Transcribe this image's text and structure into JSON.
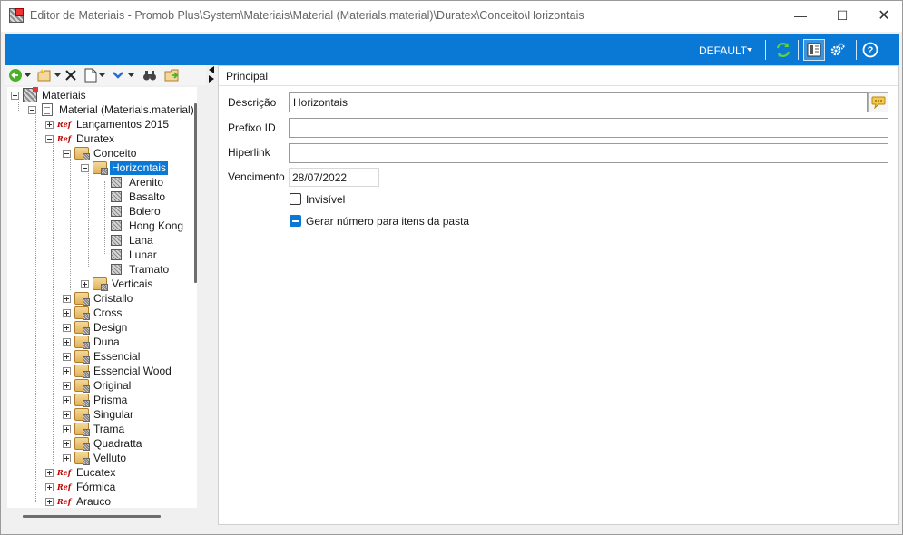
{
  "window": {
    "title": "Editor de Materiais - Promob Plus\\System\\Materiais\\Material (Materials.material)\\Duratex\\Conceito\\Horizontais",
    "minimize_glyph": "—",
    "maximize_glyph": "☐",
    "close_glyph": "✕"
  },
  "ribbon": {
    "profile_label": "DEFAULT",
    "icons": [
      "refresh-icon",
      "layout-icon",
      "settings-icon",
      "help-icon"
    ],
    "accent_color": "#0a79d6"
  },
  "tree": {
    "root_label": "Materiais",
    "material_label": "Material (Materials.material)",
    "items": {
      "lancamentos": "Lançamentos 2015",
      "duratex": "Duratex",
      "conceito": "Conceito",
      "horizontais": "Horizontais",
      "arenito": "Arenito",
      "basalto": "Basalto",
      "bolero": "Bolero",
      "hong_kong": "Hong Kong",
      "lana": "Lana",
      "lunar": "Lunar",
      "tramato": "Tramato",
      "verticais": "Verticais",
      "cristallo": "Cristallo",
      "cross": "Cross",
      "design": "Design",
      "duna": "Duna",
      "essencial": "Essencial",
      "essencial_wood": "Essencial Wood",
      "original": "Original",
      "prisma": "Prisma",
      "singular": "Singular",
      "trama": "Trama",
      "quadratta": "Quadratta",
      "velluto": "Velluto",
      "eucatex": "Eucatex",
      "formica": "Fórmica",
      "arauco": "Arauco"
    },
    "ref_tag": "Ref"
  },
  "form": {
    "section_title": "Principal",
    "descricao_label": "Descrição",
    "descricao_value": "Horizontais",
    "prefixo_label": "Prefixo ID",
    "prefixo_value": "",
    "hiperlink_label": "Hiperlink",
    "hiperlink_value": "",
    "vencimento_label": "Vencimento",
    "vencimento_value": "28/07/2022",
    "invisivel_label": "Invisível",
    "gerar_label": "Gerar número para itens da pasta"
  }
}
